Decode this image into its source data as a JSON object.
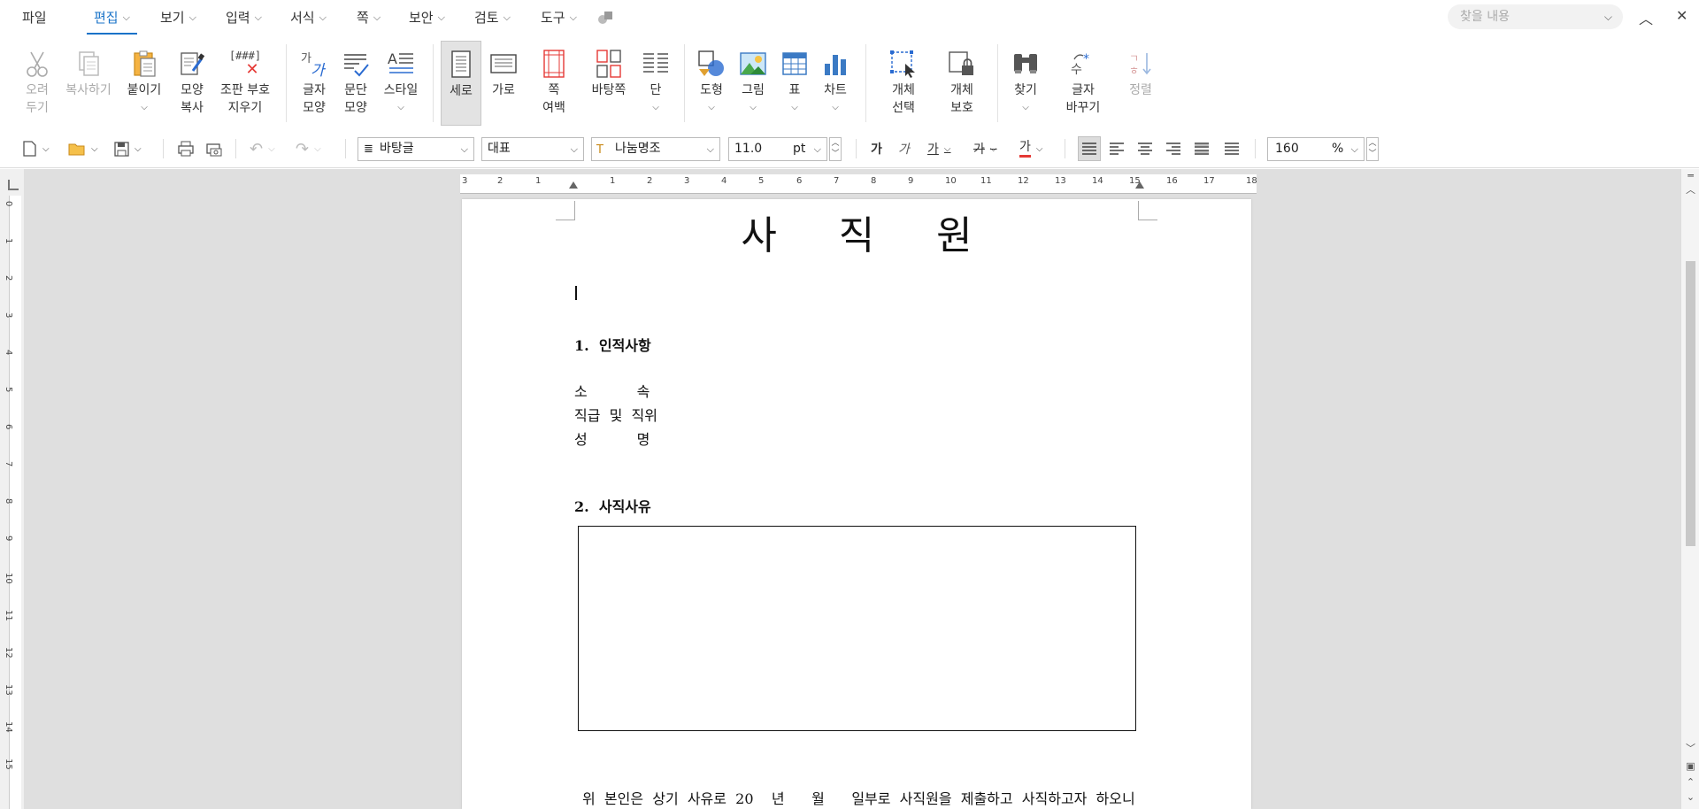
{
  "menubar": {
    "file": "파일",
    "tabs": [
      {
        "label": "편집"
      },
      {
        "label": "보기"
      },
      {
        "label": "입력"
      },
      {
        "label": "서식"
      },
      {
        "label": "쪽"
      },
      {
        "label": "보안"
      },
      {
        "label": "검토"
      },
      {
        "label": "도구"
      }
    ],
    "search_placeholder": "찾을 내용"
  },
  "ribbon": {
    "cut": [
      "오려",
      "두기"
    ],
    "copy": "복사하기",
    "paste": "붙이기",
    "format_copy": [
      "모양",
      "복사"
    ],
    "clear_codes": [
      "조판 부호",
      "지우기"
    ],
    "clear_codes_icon_text": "[###]",
    "char_shape": [
      "글자",
      "모양"
    ],
    "para_shape": [
      "문단",
      "모양"
    ],
    "style": "스타일",
    "portrait": "세로",
    "landscape": "가로",
    "page_margin": [
      "쪽",
      "여백"
    ],
    "background_page": "바탕쪽",
    "columns": "단",
    "shape": "도형",
    "picture": "그림",
    "table": "표",
    "chart": "차트",
    "object_select": [
      "개체",
      "선택"
    ],
    "object_protect": [
      "개체",
      "보호"
    ],
    "find": "찾기",
    "replace_char": [
      "글자",
      "바꾸기"
    ],
    "sort": "정렬"
  },
  "toolbar": {
    "style_name": "바탕글",
    "language": "대표",
    "font": "나눔명조",
    "font_size": "11.0",
    "unit": "pt",
    "bold": "가",
    "italic": "가",
    "underline": "가",
    "strike": "가",
    "color": "가",
    "zoom": "160",
    "zoom_unit": "%"
  },
  "ruler": {
    "h_labels": [
      "3",
      "2",
      "1",
      "",
      "1",
      "2",
      "3",
      "4",
      "5",
      "6",
      "7",
      "8",
      "9",
      "10",
      "11",
      "12",
      "13",
      "14",
      "15",
      "16",
      "17",
      "18"
    ],
    "v_labels": [
      "0",
      "1",
      "2",
      "3",
      "4",
      "5",
      "6",
      "7",
      "8",
      "9",
      "10",
      "11",
      "12",
      "13",
      "14",
      "15"
    ]
  },
  "document": {
    "title": "사     직     원",
    "section1": "1.  인적사항",
    "affiliation": "소           속",
    "position": "직급  및  직위",
    "name": "성           명",
    "section2": "2.  사직사유",
    "statement": "위  본인은  상기  사유로  20    년      월      일부로  사직원을  제출하고  사직하고자  하오니"
  },
  "colors": {
    "accent": "#1a73c8",
    "font_color": "#e53935"
  }
}
